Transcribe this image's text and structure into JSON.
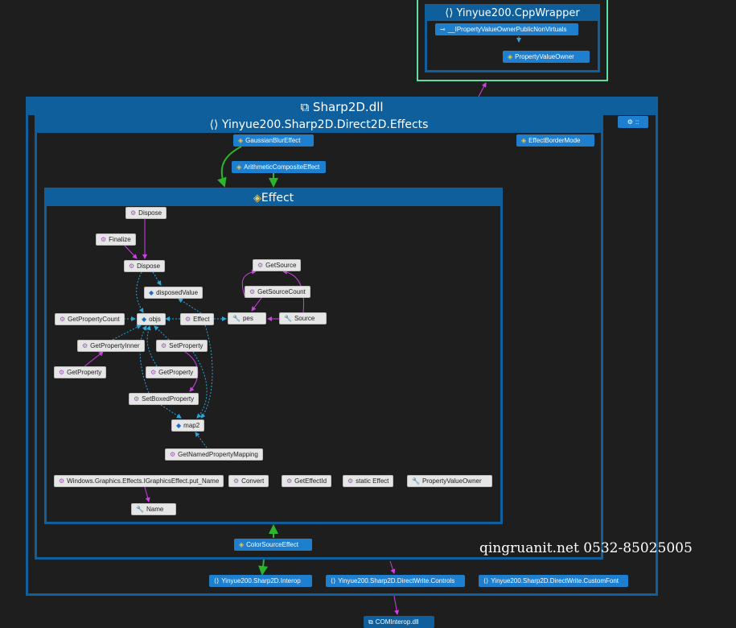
{
  "cppwrapper": {
    "title": "Yinyue200.CppWrapper",
    "nodes": {
      "iprop": "__IPropertyValueOwnerPublicNonVirtuals",
      "pvo": "PropertyValueOwner"
    }
  },
  "sharp2d": {
    "title": "Sharp2D.dll",
    "ext_label": "::",
    "effects_ns": {
      "title": "Yinyue200.Sharp2D.Direct2D.Effects",
      "gaussian": "GaussianBlurEffect",
      "arith": "ArithmeticCompositeEffect",
      "border": "EffectBorderMode",
      "colorsource": "ColorSourceEffect",
      "effect": {
        "title": "Effect",
        "members": {
          "dispose1": "Dispose",
          "finalize": "Finalize",
          "dispose2": "Dispose",
          "disposedValue": "disposedValue",
          "getSource": "GetSource",
          "getSourceCount": "GetSourceCount",
          "getPropertyCount": "GetPropertyCount",
          "objs": "objs",
          "effectCtor": "Effect",
          "pes": "pes",
          "source": "Source",
          "getPropertyInner": "GetPropertyInner",
          "setProperty": "SetProperty",
          "getProperty1": "GetProperty",
          "getProperty2": "GetProperty",
          "setBoxedProperty": "SetBoxedProperty",
          "map2": "map2",
          "getNamedPropertyMapping": "GetNamedPropertyMapping",
          "putName": "Windows.Graphics.Effects.IGraphicsEffect.put_Name",
          "convert": "Convert",
          "getEffectId": "GetEffectId",
          "staticEffect": "static Effect",
          "propertyValueOwner": "PropertyValueOwner",
          "name": "Name"
        }
      }
    },
    "bottom": {
      "interop": "Yinyue200.Sharp2D.Interop",
      "controls": "Yinyue200.Sharp2D.DirectWrite.Controls",
      "customfont": "Yinyue200.Sharp2D.DirectWrite.CustomFont"
    }
  },
  "cominterop": "COMInterop.dll",
  "watermark": "qingruanit.net 0532-85025005",
  "colors": {
    "panel": "#0e5f9c",
    "node_blue": "#1f7fcf",
    "green_outline": "#5fe0a0",
    "magenta": "#d03ee8",
    "cyan": "#2aa6d8",
    "green": "#2bb52b"
  }
}
